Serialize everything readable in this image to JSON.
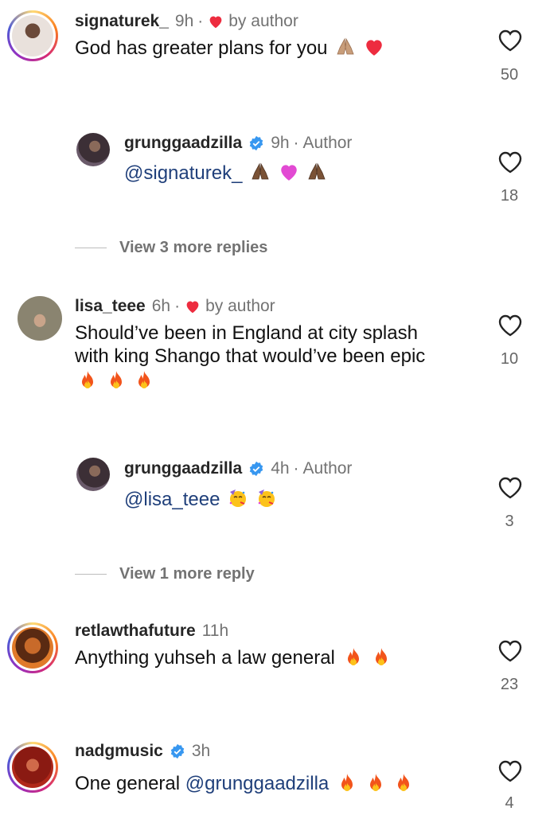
{
  "comments": [
    {
      "username": "signaturek_",
      "time": "9h",
      "by_author": "by author",
      "text": "God has greater plans for you",
      "likes": "50"
    },
    {
      "username": "grunggaadzilla",
      "time": "9h",
      "author_tag": "Author",
      "mention": "@signaturek_",
      "likes": "18"
    },
    {
      "username": "lisa_teee",
      "time": "6h",
      "by_author": "by author",
      "text_line1": "Should’ve been in England at city splash",
      "text_line2": "with king Shango that would’ve been epic",
      "likes": "10"
    },
    {
      "username": "grunggaadzilla",
      "time": "4h",
      "author_tag": "Author",
      "mention": "@lisa_teee",
      "likes": "3"
    },
    {
      "username": "retlawthafuture",
      "time": "11h",
      "text": "Anything yuhseh a law general",
      "likes": "23"
    },
    {
      "username": "nadgmusic",
      "time": "3h",
      "text": "One general ",
      "mention": "@grunggaadzilla",
      "likes": "4"
    }
  ],
  "view_more": [
    "View 3 more replies",
    "View 1 more reply"
  ],
  "separator": "·",
  "colors": {
    "heart_red": "#ed2c3f",
    "mention_blue": "#1f3f7a",
    "verified_blue": "#3797f0",
    "meta_gray": "#737373"
  }
}
